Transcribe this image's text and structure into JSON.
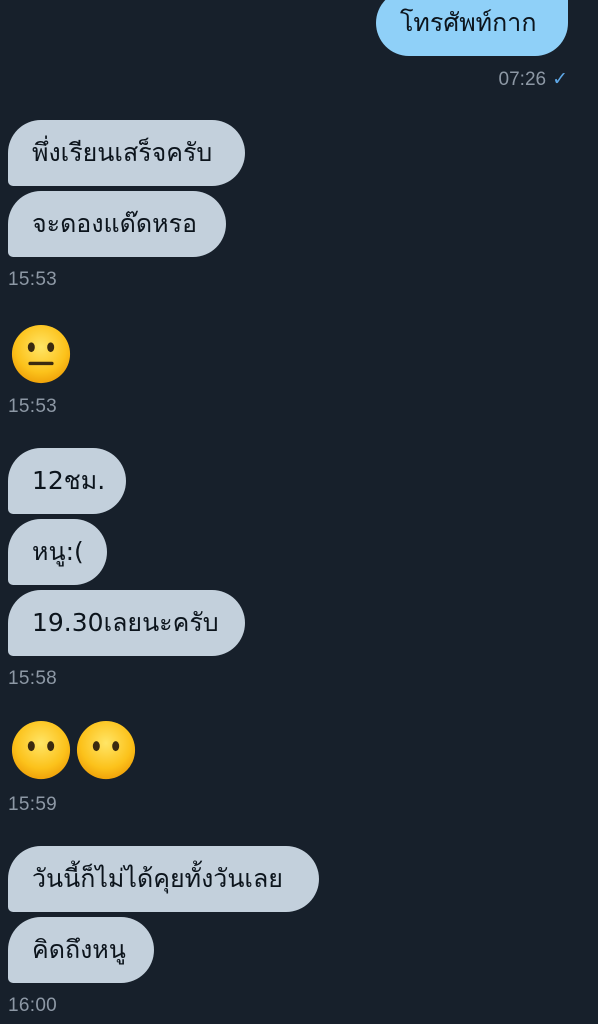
{
  "conversation": {
    "outgoing": [
      {
        "text": "โทรศัพท์กาก",
        "time": "07:26",
        "status_icon": "checkmark-icon"
      }
    ],
    "incoming_groups": [
      {
        "messages": [
          "พึ่งเรียนเสร็จครับ",
          "จะดองแด๊ดหรอ"
        ],
        "time": "15:53"
      },
      {
        "emojis": [
          "neutral-face"
        ],
        "time": "15:53"
      },
      {
        "messages": [
          "12ชม.",
          "หนู:(",
          "19.30เลยนะครับ"
        ],
        "time": "15:58"
      },
      {
        "emojis": [
          "face-without-mouth",
          "face-without-mouth"
        ],
        "time": "15:59"
      },
      {
        "messages": [
          "วันนี้ก็ไม่ได้คุยทั้งวันเลย",
          "คิดถึงหนู"
        ],
        "time": "16:00"
      }
    ]
  },
  "colors": {
    "background": "#17202b",
    "incoming_bubble": "#c3d0dc",
    "outgoing_bubble": "#8fd0f8",
    "timestamp": "#8d98a5",
    "checkmark": "#5ea7e6"
  }
}
